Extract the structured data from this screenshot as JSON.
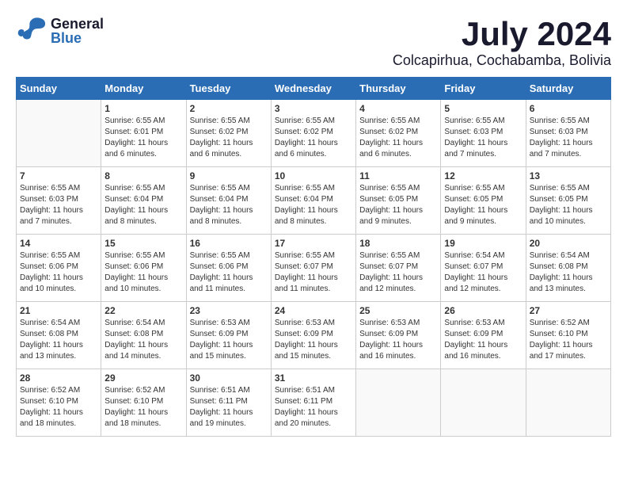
{
  "header": {
    "logo": {
      "general": "General",
      "blue": "Blue"
    },
    "month": "July 2024",
    "location": "Colcapirhua, Cochabamba, Bolivia"
  },
  "weekdays": [
    "Sunday",
    "Monday",
    "Tuesday",
    "Wednesday",
    "Thursday",
    "Friday",
    "Saturday"
  ],
  "weeks": [
    [
      {
        "day": "",
        "info": ""
      },
      {
        "day": "1",
        "info": "Sunrise: 6:55 AM\nSunset: 6:01 PM\nDaylight: 11 hours\nand 6 minutes."
      },
      {
        "day": "2",
        "info": "Sunrise: 6:55 AM\nSunset: 6:02 PM\nDaylight: 11 hours\nand 6 minutes."
      },
      {
        "day": "3",
        "info": "Sunrise: 6:55 AM\nSunset: 6:02 PM\nDaylight: 11 hours\nand 6 minutes."
      },
      {
        "day": "4",
        "info": "Sunrise: 6:55 AM\nSunset: 6:02 PM\nDaylight: 11 hours\nand 6 minutes."
      },
      {
        "day": "5",
        "info": "Sunrise: 6:55 AM\nSunset: 6:03 PM\nDaylight: 11 hours\nand 7 minutes."
      },
      {
        "day": "6",
        "info": "Sunrise: 6:55 AM\nSunset: 6:03 PM\nDaylight: 11 hours\nand 7 minutes."
      }
    ],
    [
      {
        "day": "7",
        "info": "Sunrise: 6:55 AM\nSunset: 6:03 PM\nDaylight: 11 hours\nand 7 minutes."
      },
      {
        "day": "8",
        "info": "Sunrise: 6:55 AM\nSunset: 6:04 PM\nDaylight: 11 hours\nand 8 minutes."
      },
      {
        "day": "9",
        "info": "Sunrise: 6:55 AM\nSunset: 6:04 PM\nDaylight: 11 hours\nand 8 minutes."
      },
      {
        "day": "10",
        "info": "Sunrise: 6:55 AM\nSunset: 6:04 PM\nDaylight: 11 hours\nand 8 minutes."
      },
      {
        "day": "11",
        "info": "Sunrise: 6:55 AM\nSunset: 6:05 PM\nDaylight: 11 hours\nand 9 minutes."
      },
      {
        "day": "12",
        "info": "Sunrise: 6:55 AM\nSunset: 6:05 PM\nDaylight: 11 hours\nand 9 minutes."
      },
      {
        "day": "13",
        "info": "Sunrise: 6:55 AM\nSunset: 6:05 PM\nDaylight: 11 hours\nand 10 minutes."
      }
    ],
    [
      {
        "day": "14",
        "info": "Sunrise: 6:55 AM\nSunset: 6:06 PM\nDaylight: 11 hours\nand 10 minutes."
      },
      {
        "day": "15",
        "info": "Sunrise: 6:55 AM\nSunset: 6:06 PM\nDaylight: 11 hours\nand 10 minutes."
      },
      {
        "day": "16",
        "info": "Sunrise: 6:55 AM\nSunset: 6:06 PM\nDaylight: 11 hours\nand 11 minutes."
      },
      {
        "day": "17",
        "info": "Sunrise: 6:55 AM\nSunset: 6:07 PM\nDaylight: 11 hours\nand 11 minutes."
      },
      {
        "day": "18",
        "info": "Sunrise: 6:55 AM\nSunset: 6:07 PM\nDaylight: 11 hours\nand 12 minutes."
      },
      {
        "day": "19",
        "info": "Sunrise: 6:54 AM\nSunset: 6:07 PM\nDaylight: 11 hours\nand 12 minutes."
      },
      {
        "day": "20",
        "info": "Sunrise: 6:54 AM\nSunset: 6:08 PM\nDaylight: 11 hours\nand 13 minutes."
      }
    ],
    [
      {
        "day": "21",
        "info": "Sunrise: 6:54 AM\nSunset: 6:08 PM\nDaylight: 11 hours\nand 13 minutes."
      },
      {
        "day": "22",
        "info": "Sunrise: 6:54 AM\nSunset: 6:08 PM\nDaylight: 11 hours\nand 14 minutes."
      },
      {
        "day": "23",
        "info": "Sunrise: 6:53 AM\nSunset: 6:09 PM\nDaylight: 11 hours\nand 15 minutes."
      },
      {
        "day": "24",
        "info": "Sunrise: 6:53 AM\nSunset: 6:09 PM\nDaylight: 11 hours\nand 15 minutes."
      },
      {
        "day": "25",
        "info": "Sunrise: 6:53 AM\nSunset: 6:09 PM\nDaylight: 11 hours\nand 16 minutes."
      },
      {
        "day": "26",
        "info": "Sunrise: 6:53 AM\nSunset: 6:09 PM\nDaylight: 11 hours\nand 16 minutes."
      },
      {
        "day": "27",
        "info": "Sunrise: 6:52 AM\nSunset: 6:10 PM\nDaylight: 11 hours\nand 17 minutes."
      }
    ],
    [
      {
        "day": "28",
        "info": "Sunrise: 6:52 AM\nSunset: 6:10 PM\nDaylight: 11 hours\nand 18 minutes."
      },
      {
        "day": "29",
        "info": "Sunrise: 6:52 AM\nSunset: 6:10 PM\nDaylight: 11 hours\nand 18 minutes."
      },
      {
        "day": "30",
        "info": "Sunrise: 6:51 AM\nSunset: 6:11 PM\nDaylight: 11 hours\nand 19 minutes."
      },
      {
        "day": "31",
        "info": "Sunrise: 6:51 AM\nSunset: 6:11 PM\nDaylight: 11 hours\nand 20 minutes."
      },
      {
        "day": "",
        "info": ""
      },
      {
        "day": "",
        "info": ""
      },
      {
        "day": "",
        "info": ""
      }
    ]
  ]
}
